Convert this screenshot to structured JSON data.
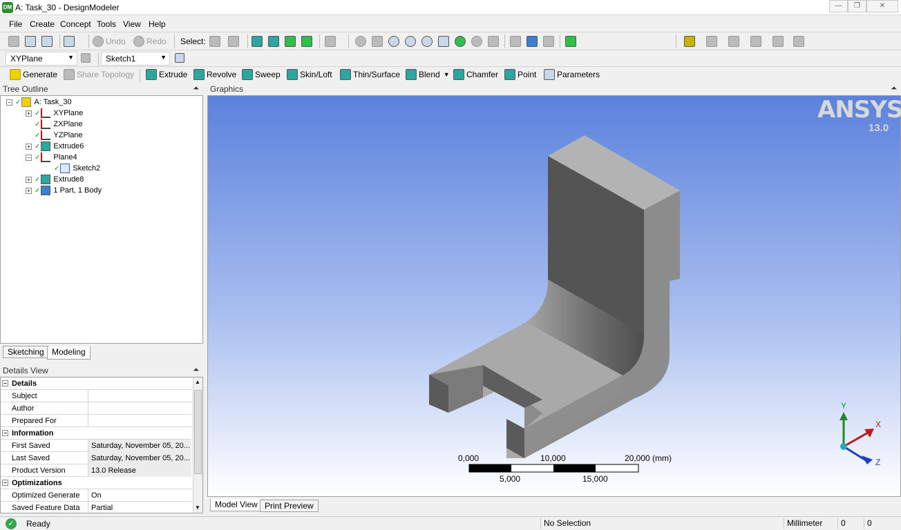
{
  "window": {
    "title": "A: Task_30 - DesignModeler",
    "icon_text": "DM"
  },
  "menu": [
    "File",
    "Create",
    "Concept",
    "Tools",
    "View",
    "Help"
  ],
  "toolbar1": {
    "undo": "Undo",
    "redo": "Redo",
    "select": "Select:"
  },
  "toolbar2": {
    "plane_combo": "XYPlane",
    "sketch_combo": "Sketch1"
  },
  "toolbar3": {
    "generate": "Generate",
    "share_topology": "Share Topology",
    "extrude": "Extrude",
    "revolve": "Revolve",
    "sweep": "Sweep",
    "skin_loft": "Skin/Loft",
    "thin_surface": "Thin/Surface",
    "blend": "Blend",
    "chamfer": "Chamfer",
    "point": "Point",
    "parameters": "Parameters"
  },
  "tree": {
    "header": "Tree Outline",
    "pin": "↑",
    "nodes": [
      "A: Task_30",
      "XYPlane",
      "ZXPlane",
      "YZPlane",
      "Extrude6",
      "Plane4",
      "Sketch2",
      "Extrude8",
      "1 Part, 1 Body"
    ]
  },
  "tree_tabs": [
    "Sketching",
    "Modeling"
  ],
  "details": {
    "header": "Details View",
    "rows": [
      {
        "section": true,
        "key": "Details",
        "value": ""
      },
      {
        "key": "Subject",
        "value": ""
      },
      {
        "key": "Author",
        "value": ""
      },
      {
        "key": "Prepared For",
        "value": ""
      },
      {
        "section": true,
        "key": "Information",
        "value": ""
      },
      {
        "key": "First Saved",
        "value": "Saturday, November 05, 20..."
      },
      {
        "key": "Last Saved",
        "value": "Saturday, November 05, 20..."
      },
      {
        "key": "Product Version",
        "value": "13.0  Release"
      },
      {
        "section": true,
        "key": "Optimizations",
        "value": ""
      },
      {
        "key": "Optimized Generate",
        "value": "On"
      },
      {
        "key": "Saved Feature Data",
        "value": "Partial"
      }
    ]
  },
  "graphics": {
    "header": "Graphics",
    "brand": "ANSYS",
    "version": "13.0",
    "scale_top": [
      "0,000",
      "10,000",
      "20,000 (mm)"
    ],
    "scale_bottom": [
      "5,000",
      "15,000"
    ],
    "axis_labels": {
      "x": "X",
      "y": "Y",
      "z": "Z"
    }
  },
  "graphics_tabs": [
    "Model View",
    "Print Preview"
  ],
  "status": {
    "ready": "Ready",
    "selection": "No Selection",
    "units": "Millimeter",
    "field1": "0",
    "field2": "0"
  }
}
